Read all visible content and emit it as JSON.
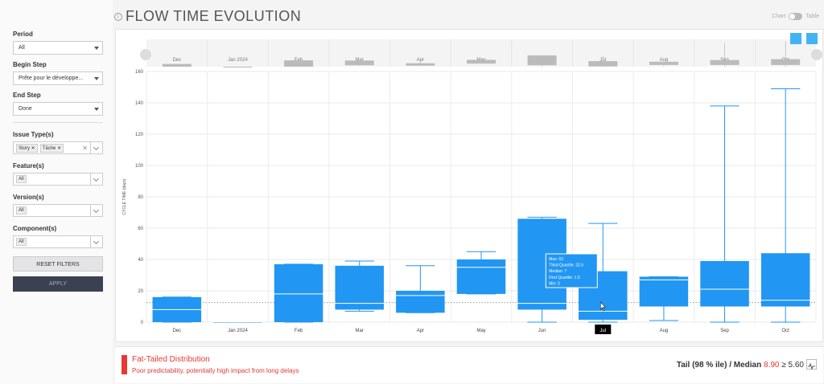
{
  "header": {
    "title": "FLOW TIME EVOLUTION",
    "toggle_left": "Chart",
    "toggle_right": "Table"
  },
  "filters": {
    "period_label": "Period",
    "period_value": "All",
    "begin_label": "Begin Step",
    "begin_value": "Prête pour le développe...",
    "end_label": "End Step",
    "end_value": "Done",
    "issue_label": "Issue Type(s)",
    "issue_tags": [
      "Story",
      "Tâche"
    ],
    "feature_label": "Feature(s)",
    "feature_value": "All",
    "version_label": "Version(s)",
    "version_value": "All",
    "component_label": "Component(s)",
    "component_value": "All",
    "reset_label": "RESET FILTERS",
    "apply_label": "APPLY"
  },
  "navigator_labels": [
    "Dec",
    "Jan 2024",
    "Feb",
    "Mar",
    "Apr",
    "May",
    "Jun",
    "Jul",
    "Aug",
    "Sep",
    "Oct"
  ],
  "chart_data": {
    "type": "box",
    "ylabel": "CYCLE TIME (days)",
    "ylim": [
      0,
      160
    ],
    "yticks": [
      0,
      20,
      40,
      60,
      80,
      100,
      120,
      140,
      160
    ],
    "categories": [
      "Dec",
      "Jan 2024",
      "Feb",
      "Mar",
      "Apr",
      "May",
      "Jun",
      "Jul",
      "Aug",
      "Sep",
      "Oct"
    ],
    "boxes": [
      {
        "min": 0,
        "q1": 0,
        "median": 8,
        "q3": 16,
        "max": 16
      },
      {
        "min": 0,
        "q1": 0,
        "median": 0,
        "q3": 0,
        "max": 0
      },
      {
        "min": 0,
        "q1": 0,
        "median": 18,
        "q3": 37,
        "max": 37
      },
      {
        "min": 7,
        "q1": 8,
        "median": 12,
        "q3": 36,
        "max": 39
      },
      {
        "min": 6,
        "q1": 6,
        "median": 17,
        "q3": 20,
        "max": 36
      },
      {
        "min": 18,
        "q1": 18,
        "median": 35,
        "q3": 40,
        "max": 45
      },
      {
        "min": 0,
        "q1": 8,
        "median": 12,
        "q3": 66,
        "max": 67
      },
      {
        "min": 0,
        "q1": 1.5,
        "median": 7,
        "q3": 32.5,
        "max": 63
      },
      {
        "min": 1,
        "q1": 10,
        "median": 27,
        "q3": 29,
        "max": 29
      },
      {
        "min": 0,
        "q1": 10,
        "median": 21,
        "q3": 39,
        "max": 138
      },
      {
        "min": 0,
        "q1": 10,
        "median": 14,
        "q3": 44,
        "max": 149
      }
    ],
    "reference_line": 12.5,
    "tooltip": {
      "category": "Jul",
      "lines": [
        "Max: 63",
        "Third Quartile: 32.5",
        "Median: 7",
        "First Quartile: 1.5",
        "Min: 0"
      ]
    },
    "box_color": "#2196f3"
  },
  "footer": {
    "status_title": "Fat-Tailed Distribution",
    "status_sub": "Poor predictability, potentially high impact from long delays",
    "tail_label": "Tail (98 % ile) / Median",
    "tail_value": "8.90",
    "tail_cmp": "≥ 5.60"
  }
}
